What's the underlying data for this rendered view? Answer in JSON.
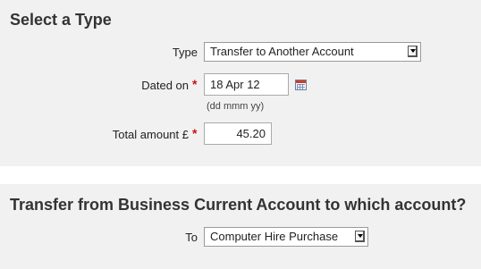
{
  "section1": {
    "heading": "Select a Type",
    "type_label": "Type",
    "type_value": "Transfer to Another Account",
    "date_label": "Dated on",
    "date_value": "18 Apr 12",
    "date_hint": "(dd mmm yy)",
    "amount_label": "Total amount £",
    "amount_value": "45.20",
    "required_mark": "*"
  },
  "section2": {
    "heading": "Transfer from Business Current Account to which account?",
    "to_label": "To",
    "to_value": "Computer Hire Purchase"
  },
  "colors": {
    "panel_bg": "#f1f1f1",
    "required": "#d01010"
  }
}
